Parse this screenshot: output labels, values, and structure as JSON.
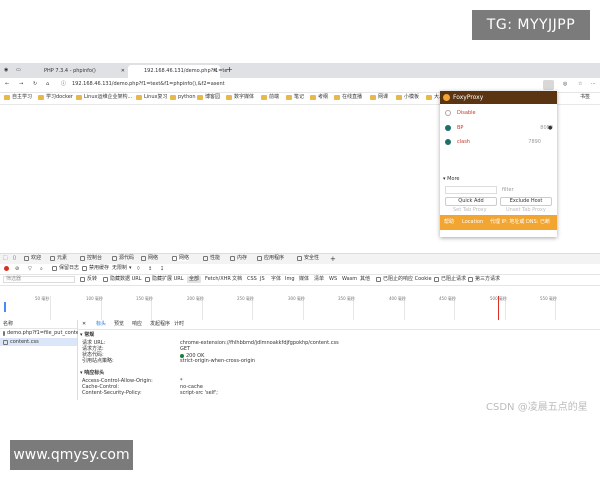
{
  "watermarks": {
    "tg": "TG: MYYJJPP",
    "site": "www.qmysy.com",
    "csdn": "CSDN @凌晨五点的星"
  },
  "tabs": [
    {
      "label": "PHP 7.3.4 - phpinfo()",
      "active": false
    },
    {
      "label": "192.168.46.131/demo.php?f1=te",
      "active": true
    }
  ],
  "new_tab": "+",
  "address": {
    "url": "192.168.46.131/demo.php?f1=text&f1=phpinfo(),&f2=asent"
  },
  "bookmarks": [
    "自主学习",
    "学习docker",
    "Linux运维企业架构...",
    "Linux复习",
    "python",
    "博客园",
    "数字媒体",
    "前端",
    "笔记",
    "考纲",
    "在线直播",
    "网课",
    "小模板",
    "大..."
  ],
  "bookmark_right": "书签",
  "foxyproxy": {
    "title": "FoxyProxy",
    "disable": "Disable",
    "proxies": [
      {
        "name": "BP",
        "port": "8080"
      },
      {
        "name": "clash",
        "port": "7890"
      }
    ],
    "more": "▾ More",
    "filter": "filter",
    "quick_add": "Quick Add",
    "exclude_host": "Exclude Host",
    "set_tab_proxy": "Set Tab Proxy",
    "unset_tab_proxy": "Unset Tab Proxy",
    "footer": [
      "帮助",
      "Location",
      "代理 IP: 地址或 DNS: 已断"
    ],
    "colors": {
      "header": "#5b3512",
      "footer": "#f2a531",
      "dot": "#1e6f6a"
    }
  },
  "devtools": {
    "tabs": [
      "欢迎",
      "元素",
      "控制台",
      "源代码",
      "网络",
      "性能",
      "内存",
      "应用程序",
      "安全性"
    ],
    "active_tab": "网络",
    "row2": [
      "保留日志",
      "禁用缓存",
      "无限制"
    ],
    "row3": {
      "filter_placeholder": "筛选器",
      "opts": [
        "反转",
        "隐藏数据 URL",
        "隐藏扩展 URL"
      ],
      "types": [
        "全部",
        "Fetch/XHR",
        "文档",
        "CSS",
        "JS",
        "字体",
        "Img",
        "媒体",
        "清单",
        "WS",
        "Wasm",
        "其他"
      ],
      "extra": [
        "已阻止的响应 Cookie",
        "已阻止请求",
        "第三方请求"
      ]
    },
    "timeline_ticks": [
      "50 毫秒",
      "100 毫秒",
      "150 毫秒",
      "200 毫秒",
      "250 毫秒",
      "300 毫秒",
      "350 毫秒",
      "400 毫秒",
      "450 毫秒",
      "500 毫秒",
      "550 毫秒"
    ],
    "list_header": "名称",
    "requests": [
      "demo.php?f1=file_put_content...",
      "content.css"
    ],
    "detail_tabs": [
      "标头",
      "预览",
      "响应",
      "发起程序",
      "计时"
    ],
    "general_title": "▾ 常规",
    "general": [
      {
        "k": "请求 URL:",
        "v": "chrome-extension://fhlhbbmd/jdlmnoakkfdjfgpokhp/content.css"
      },
      {
        "k": "请求方法:",
        "v": "GET"
      },
      {
        "k": "状态代码:",
        "v": "200 OK"
      },
      {
        "k": "引用站点策略:",
        "v": "strict-origin-when-cross-origin"
      }
    ],
    "response_title": "▾ 响应标头",
    "response": [
      {
        "k": "Access-Control-Allow-Origin:",
        "v": "*"
      },
      {
        "k": "Cache-Control:",
        "v": "no-cache"
      },
      {
        "k": "Content-Security-Policy:",
        "v": "script-src 'self';"
      }
    ]
  }
}
